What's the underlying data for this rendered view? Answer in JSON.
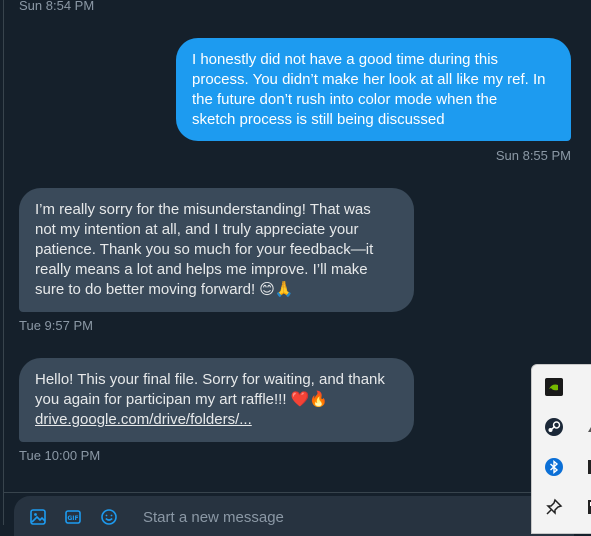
{
  "messages": [
    {
      "direction": "out",
      "lines": [
        "I honestly did not have a good time during this",
        "process. You didn’t make her look at all like my ref. In",
        "the future don’t rush into color mode when the",
        "sketch process is still being discussed"
      ],
      "time": "Sun 8:55 PM"
    },
    {
      "direction": "in",
      "lines": [
        "I’m really sorry for the misunderstanding! That was",
        "not my intention at all, and I truly appreciate your",
        "patience. Thank you so much for your feedback—it",
        "really means a lot and helps me improve. I’ll make",
        "sure to do better moving forward! 😊🙏"
      ],
      "time": "Tue 9:57 PM"
    },
    {
      "direction": "in",
      "lines": [
        "Hello! This your final file. Sorry for waiting, and thank",
        "you again for participan my art raffle!!! ❤️🔥"
      ],
      "link": "drive.google.com/drive/folders/...",
      "time": "Tue 10:00 PM"
    }
  ],
  "top_time": "Sun 8:54 PM",
  "composer": {
    "placeholder": "Start a new message",
    "icons": [
      "image-icon",
      "gif-icon",
      "emoji-icon"
    ],
    "accent": "#1d9bf0"
  },
  "tray_icons": [
    "nvidia-icon",
    "steam-icon",
    "bluetooth-icon",
    "pin-icon"
  ],
  "colors": {
    "background": "#15202b",
    "outgoing_bubble": "#1d9bf0",
    "incoming_bubble": "#3a4a5a",
    "timestamp": "#8b98a5"
  }
}
